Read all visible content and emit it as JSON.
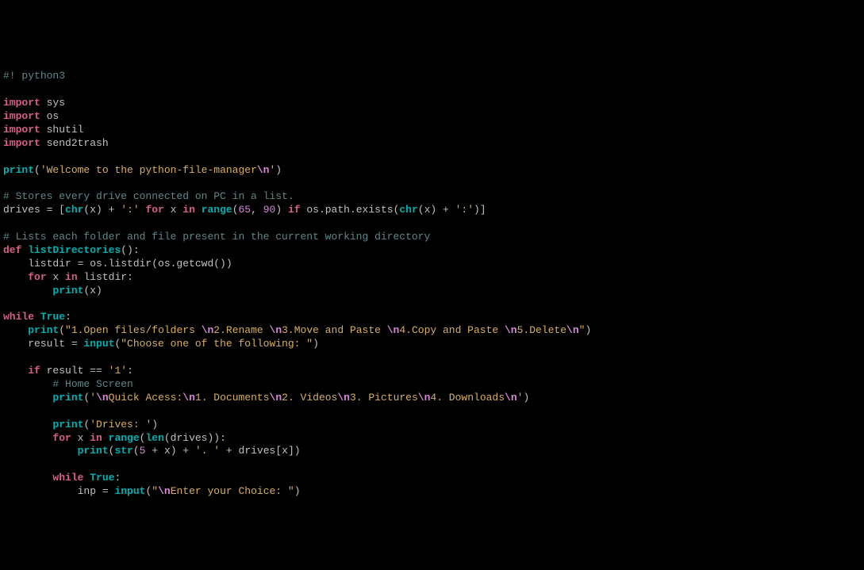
{
  "shebang": {
    "hash": "#!",
    "text": " python3"
  },
  "imports": [
    {
      "kw": "import",
      "mod": " sys"
    },
    {
      "kw": "import",
      "mod": " os"
    },
    {
      "kw": "import",
      "mod": " shutil"
    },
    {
      "kw": "import",
      "mod": " send2trash"
    }
  ],
  "welcome": {
    "print": "print",
    "str1": "'Welcome to the python-file-manager",
    "esc1": "\\n",
    "str2": "'"
  },
  "comment1": "# Stores every drive connected on PC in a list.",
  "drives_line": {
    "var": "drives = [",
    "chr1": "chr",
    "p1": "(x) + ",
    "s1": "':'",
    "for": " for",
    "x": " x ",
    "in": "in",
    "range": " range",
    "p2": "(",
    "n1": "65",
    "c1": ", ",
    "n2": "90",
    "p3": ") ",
    "if": "if",
    "ospe": " os.path.exists(",
    "chr2": "chr",
    "p4": "(x) + ",
    "s2": "':'",
    "p5": ")]"
  },
  "comment2": "# Lists each folder and file present in the current working directory",
  "funcdef": {
    "def": "def",
    "name": " listDirectories",
    "paren": "():"
  },
  "body1": "    listdir = os.listdir(os.getcwd())",
  "body2_for": "for",
  "body2_rest": " x ",
  "body2_in": "in",
  "body2_end": " listdir:",
  "body3_print": "print",
  "body3_rest": "(x)",
  "while1": "while",
  "true1": " True",
  "colon1": ":",
  "menu_print": "print",
  "menu_s1": "\"1.Open files/folders ",
  "menu_e1": "\\n",
  "menu_s2": "2.Rename ",
  "menu_e2": "\\n",
  "menu_s3": "3.Move and Paste ",
  "menu_e3": "\\n",
  "menu_s4": "4.Copy and Paste ",
  "menu_e4": "\\n",
  "menu_s5": "5.Delete",
  "menu_e5": "\\n",
  "menu_s6": "\"",
  "result_var": "    result = ",
  "input1": "input",
  "result_str": "\"Choose one of the following: \"",
  "if1": "if",
  "if1_rest": " result == ",
  "if1_str": "'1'",
  "if1_colon": ":",
  "comment3": "        # Home Screen",
  "qa_print": "print",
  "qa_s1": "'",
  "qa_e1": "\\n",
  "qa_s2": "Quick Acess:",
  "qa_e2": "\\n",
  "qa_s3": "1. Documents",
  "qa_e3": "\\n",
  "qa_s4": "2. Videos",
  "qa_e4": "\\n",
  "qa_s5": "3. Pictures",
  "qa_e5": "\\n",
  "qa_s6": "4. Downloads",
  "qa_e6": "\\n",
  "qa_s7": "'",
  "drv_print": "print",
  "drv_str": "'Drives: '",
  "for2": "for",
  "for2_x": " x ",
  "for2_in": "in",
  "for2_range": " range",
  "for2_len": "len",
  "for2_rest": "(drives)):",
  "line_print": "print",
  "line_str": "str",
  "line_p1": "(",
  "line_n": "5",
  "line_p2": " + x) + ",
  "line_s1": "'. '",
  "line_p3": " + drives[x])",
  "while2": "while",
  "true2": " True",
  "colon2": ":",
  "inp_var": "            inp = ",
  "input2": "input",
  "inp_s1": "\"",
  "inp_e1": "\\n",
  "inp_s2": "Enter your Choice: \"",
  "indent4": "    ",
  "indent8": "        ",
  "indent12": "            "
}
